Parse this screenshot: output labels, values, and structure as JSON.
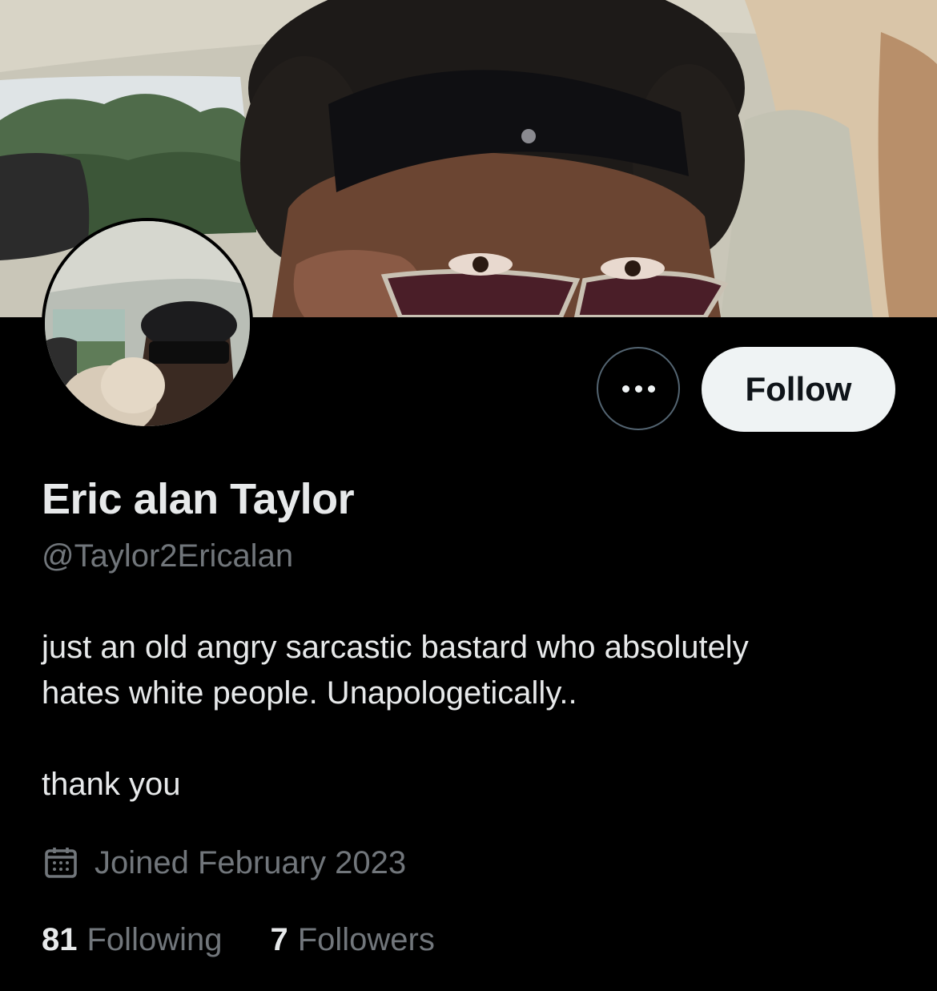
{
  "profile": {
    "display_name": "Eric alan Taylor",
    "handle": "@Taylor2Ericalan",
    "bio_line1": "just an old angry sarcastic bastard who absolutely",
    "bio_line2": "hates white people. Unapologetically..",
    "bio_line3": "thank you",
    "joined": "Joined February 2023"
  },
  "actions": {
    "follow_label": "Follow",
    "more_icon": "more-horizontal-icon"
  },
  "stats": {
    "following_count": "81",
    "following_label": "Following",
    "followers_count": "7",
    "followers_label": "Followers"
  },
  "icons": {
    "joined": "calendar-icon"
  },
  "colors": {
    "background": "#000000",
    "primary_text": "#e7e9ea",
    "secondary_text": "#71767b",
    "follow_button_bg": "#eff3f4",
    "border": "#536471"
  }
}
